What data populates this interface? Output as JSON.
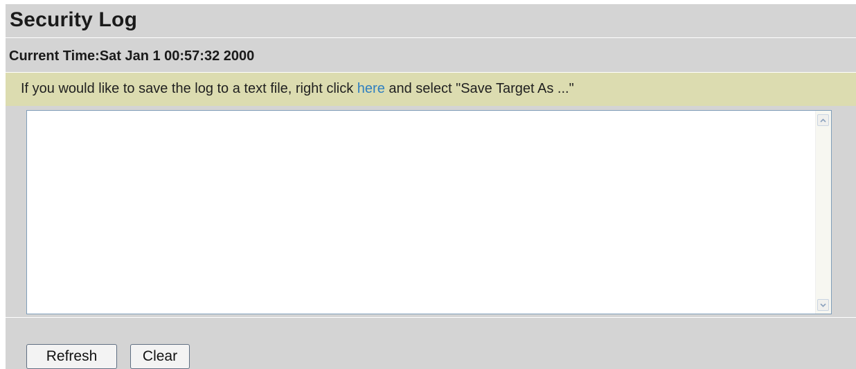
{
  "page": {
    "title": "Security Log"
  },
  "status": {
    "current_time": "Current Time:Sat Jan 1 00:57:32 2000"
  },
  "notice": {
    "text_before_link": "If you would like to save the log to a text file, right click ",
    "link_label": "here",
    "text_after_link": " and select \"Save Target As ...\""
  },
  "log": {
    "content": ""
  },
  "buttons": {
    "refresh_label": "Refresh",
    "clear_label": "Clear"
  },
  "colors": {
    "panel_background": "#d4d4d4",
    "notice_background": "#dcdcb0",
    "link": "#2f7fc0"
  }
}
